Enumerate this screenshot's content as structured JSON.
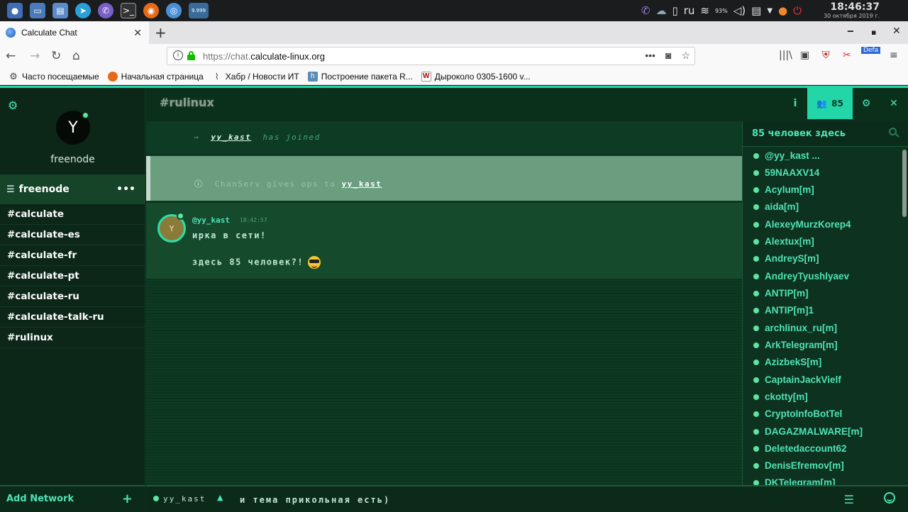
{
  "taskbar": {
    "indicator": "9.999",
    "lang": "ru",
    "battery": "93%",
    "time": "18:46:37",
    "date": "30 октября 2019 г."
  },
  "browser": {
    "tab_title": "Calculate Chat",
    "url_protocol": "https://chat.",
    "url_host": "calculate-linux.org",
    "ext_badge": "Defa",
    "bookmarks": [
      "Часто посещаемые",
      "Начальная страница",
      "Хабр / Новости ИТ",
      "Построение пакета R...",
      "Дыроколо 0305-1600 v..."
    ]
  },
  "sidebar": {
    "network_name": "freenode",
    "avatar_letter": "Y",
    "network_header": "freenode",
    "channels": [
      "#calculate",
      "#calculate-es",
      "#calculate-fr",
      "#calculate-pt",
      "#calculate-ru",
      "#calculate-talk-ru",
      "#rulinux"
    ],
    "add_network": "Add Network"
  },
  "channel": {
    "title": "#rulinux",
    "user_count": "85"
  },
  "messages": {
    "join_arrow": "→",
    "join_user": "yy_kast",
    "join_text": "has joined",
    "mode_actor": "ChanServ",
    "mode_text": "gives ops to",
    "mode_target": "yy_kast",
    "msg_nick": "@yy_kast",
    "msg_time": "18:42:57",
    "msg_avatar": "Y",
    "msg_lines": [
      "ирка в сети!",
      "здесь 85 человек?!"
    ]
  },
  "userlist": {
    "header": "85 человек здесь",
    "users": [
      "@yy_kast ...",
      "59NAAXV14",
      "Acylum[m]",
      "aida[m]",
      "AlexeyMurzKorep4",
      "Alextux[m]",
      "AndreyS[m]",
      "AndreyTyushlyaev",
      "ANTIP[m]",
      "ANTIP[m]1",
      "archlinux_ru[m]",
      "ArkTelegram[m]",
      "AzizbekS[m]",
      "CaptainJackVielf",
      "ckotty[m]",
      "CryptoInfoBotTel",
      "DAGAZMALWARE[m]",
      "Deletedaccount62",
      "DenisEfremov[m]",
      "DKTelegram[m]"
    ]
  },
  "input": {
    "nick": "yy_kast",
    "value": "и тема прикольная есть)"
  }
}
